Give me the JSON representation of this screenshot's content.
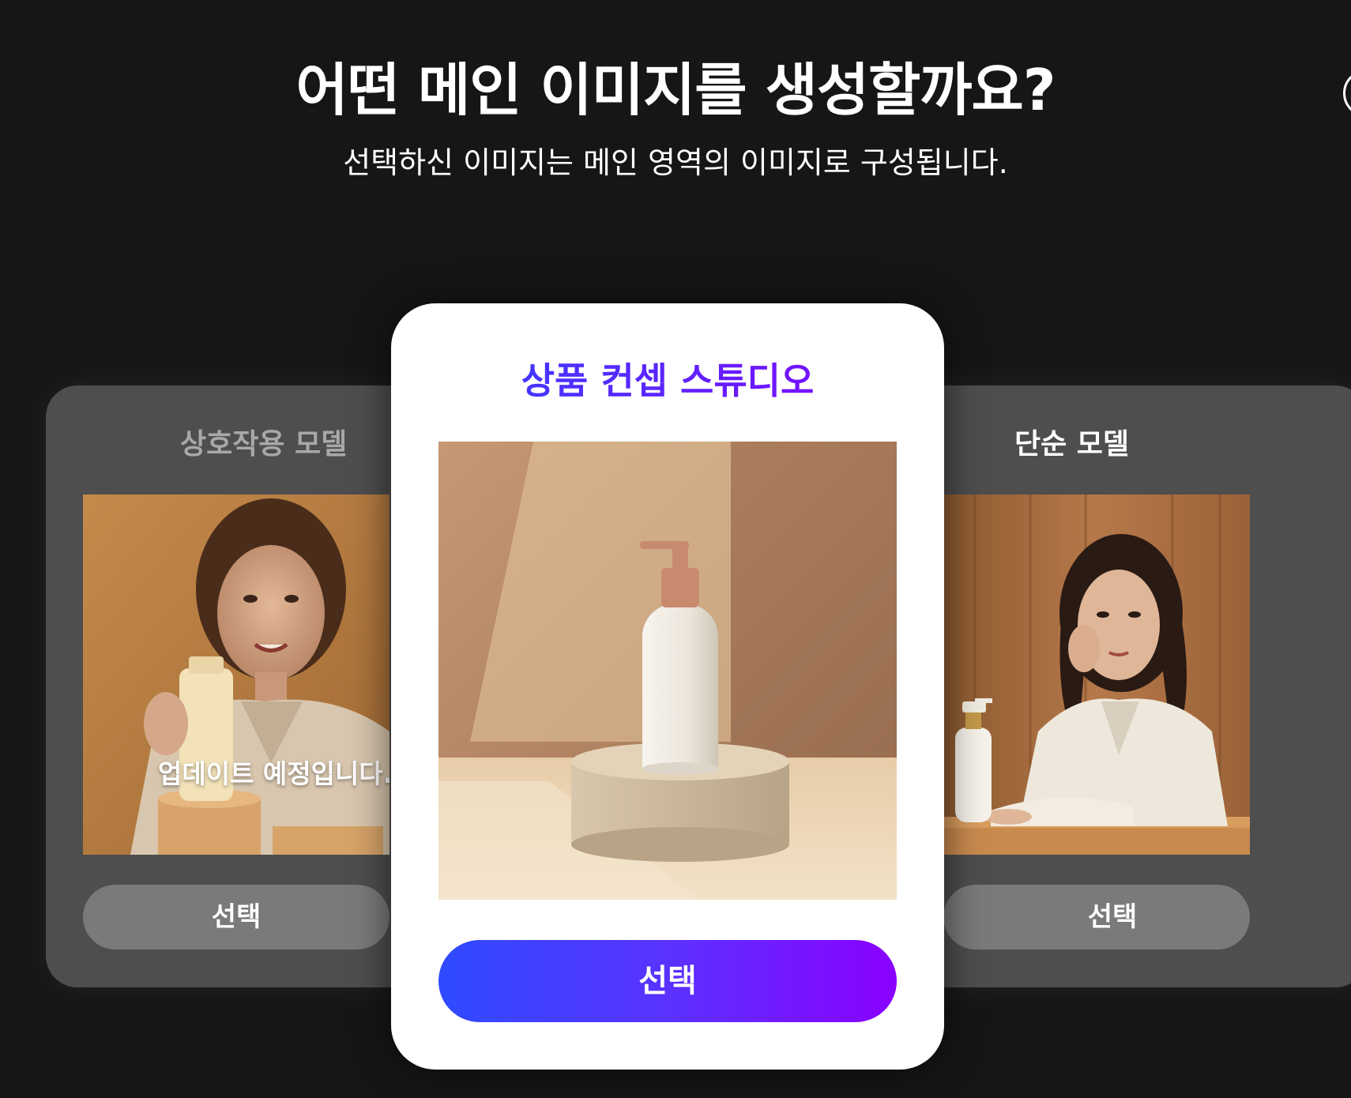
{
  "header": {
    "title": "어떤 메인 이미지를 생성할까요?",
    "subtitle": "선택하신 이미지는 메인 영역의 이미지로 구성됩니다."
  },
  "cards": {
    "left": {
      "title": "상호작용 모델",
      "overlay": "업데이트 예정입니다.",
      "button": "선택"
    },
    "center": {
      "title": "상품 컨셉 스튜디오",
      "button": "선택"
    },
    "right": {
      "title": "단순 모델",
      "button": "선택"
    }
  },
  "colors": {
    "background": "#161616",
    "side_card": "#4e4e4e",
    "gradient_start": "#2f4bff",
    "gradient_end": "#8a00ff"
  }
}
